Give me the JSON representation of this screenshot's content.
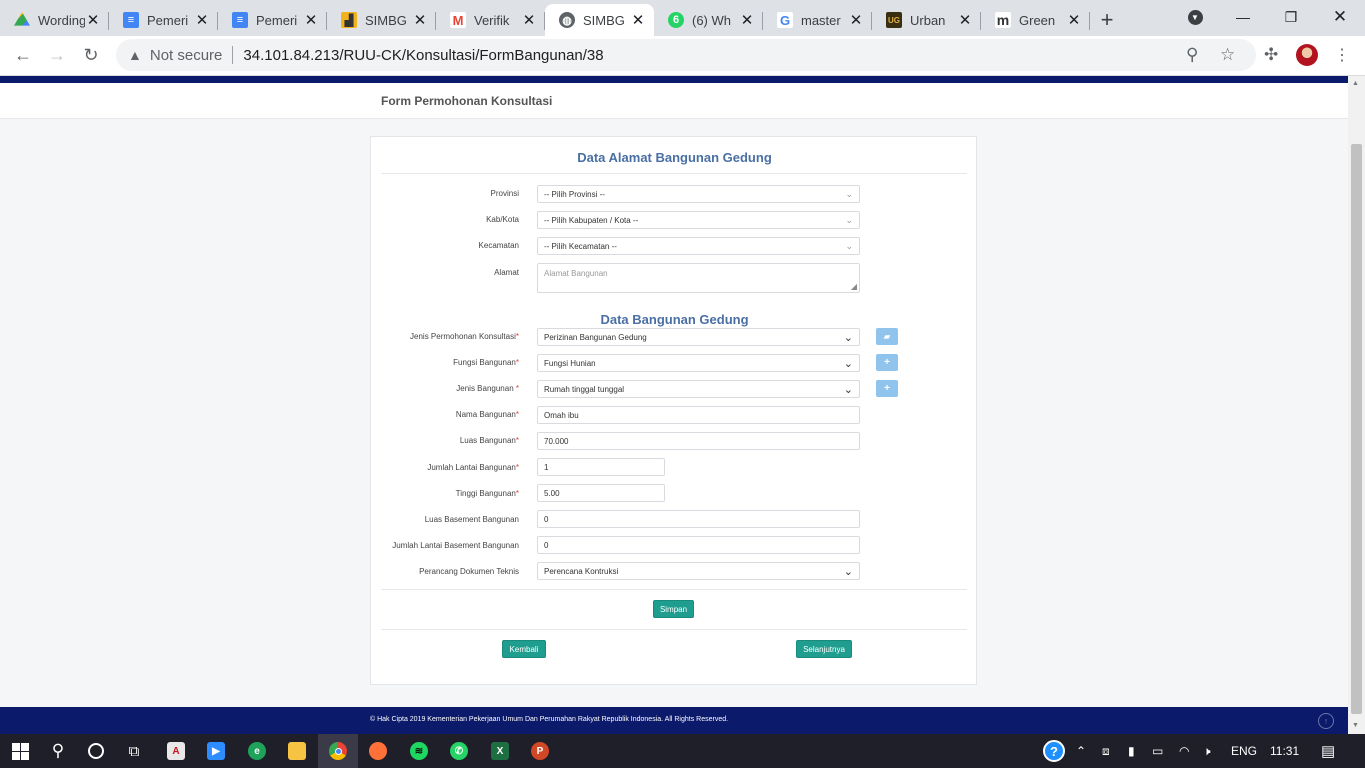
{
  "browser": {
    "tabs": [
      {
        "title": "Wording",
        "icon": "google-drive-icon",
        "color": "#34a853"
      },
      {
        "title": "Pemeri",
        "icon": "google-docs-icon",
        "color": "#4285f4"
      },
      {
        "title": "Pemeri",
        "icon": "google-docs-icon",
        "color": "#4285f4"
      },
      {
        "title": "SIMBG",
        "icon": "simbg-logo-icon",
        "color": "#f2b21d"
      },
      {
        "title": "Verifik",
        "icon": "gmail-icon",
        "color": "#ea4335"
      },
      {
        "title": "SIMBG",
        "icon": "globe-icon",
        "color": "#5f6368"
      },
      {
        "title": "(6) Wh",
        "icon": "whatsapp-icon",
        "color": "#25d366"
      },
      {
        "title": "master",
        "icon": "google-icon",
        "color": "#4285f4"
      },
      {
        "title": "Urban",
        "icon": "urban-icon",
        "color": "#b8860b"
      },
      {
        "title": "Green",
        "icon": "m-icon",
        "color": "#333333"
      }
    ],
    "active_tab": 5,
    "address": {
      "security": "Not secure",
      "url": "34.101.84.213/RUU-CK/Konsultasi/FormBangunan/38"
    }
  },
  "page": {
    "header_title": "Form Permohonan Konsultasi",
    "section1_title": "Data Alamat Bangunan Gedung",
    "section2_title": "Data Bangunan Gedung",
    "address_fields": {
      "provinsi": {
        "label": "Provinsi",
        "value": "-- Pilih Provinsi --"
      },
      "kabkota": {
        "label": "Kab/Kota",
        "value": "-- Pilih Kabupaten / Kota --"
      },
      "kecamatan": {
        "label": "Kecamatan",
        "value": "-- Pilih Kecamatan --"
      },
      "alamat": {
        "label": "Alamat",
        "placeholder": "Alamat Bangunan"
      }
    },
    "building_fields": {
      "jenis_permohonan": {
        "label": "Jenis Permohonan Konsultasi",
        "value": "Perizinan Bangunan Gedung"
      },
      "fungsi": {
        "label": "Fungsi Bangunan",
        "value": "Fungsi Hunian"
      },
      "jenis_bangunan": {
        "label": "Jenis Bangunan ",
        "value": "Rumah tinggal tunggal"
      },
      "nama": {
        "label": "Nama Bangunan",
        "value": "Omah ibu"
      },
      "luas": {
        "label": "Luas Bangunan",
        "value": "70.000"
      },
      "jumlah_lantai": {
        "label": "Jumlah Lantai Bangunan",
        "value": "1"
      },
      "tinggi": {
        "label": "Tinggi Bangunan",
        "value": "5.00"
      },
      "luas_basement": {
        "label": "Luas Basement Bangunan",
        "value": "0"
      },
      "lantai_basement": {
        "label": "Jumlah Lantai Basement Bangunan",
        "value": "0"
      },
      "perancang": {
        "label": "Perancang Dokumen Teknis",
        "value": "Perencana Kontruksi"
      }
    },
    "required_mark": "*",
    "buttons": {
      "simpan": "Simpan",
      "kembali": "Kembali",
      "selanjutnya": "Selanjutnya",
      "plus": "+"
    },
    "footer": "© Hak Cipta 2019 Kementerian Pekerjaan Umum Dan Perumahan Rakyat Republik Indonesia. All Rights Reserved."
  },
  "taskbar": {
    "language": "ENG",
    "time": "11:31",
    "apps": [
      "acrobat-icon",
      "zoom-icon",
      "edge-icon",
      "file-explorer-icon",
      "chrome-icon",
      "firefox-icon",
      "spotify-icon",
      "whatsapp-icon",
      "excel-icon",
      "powerpoint-icon"
    ]
  },
  "colors": {
    "navy": "#0b1a6b",
    "teal_button": "#1f9e8f",
    "section_title": "#4a6fa5",
    "icon_button": "#90c4ec"
  }
}
